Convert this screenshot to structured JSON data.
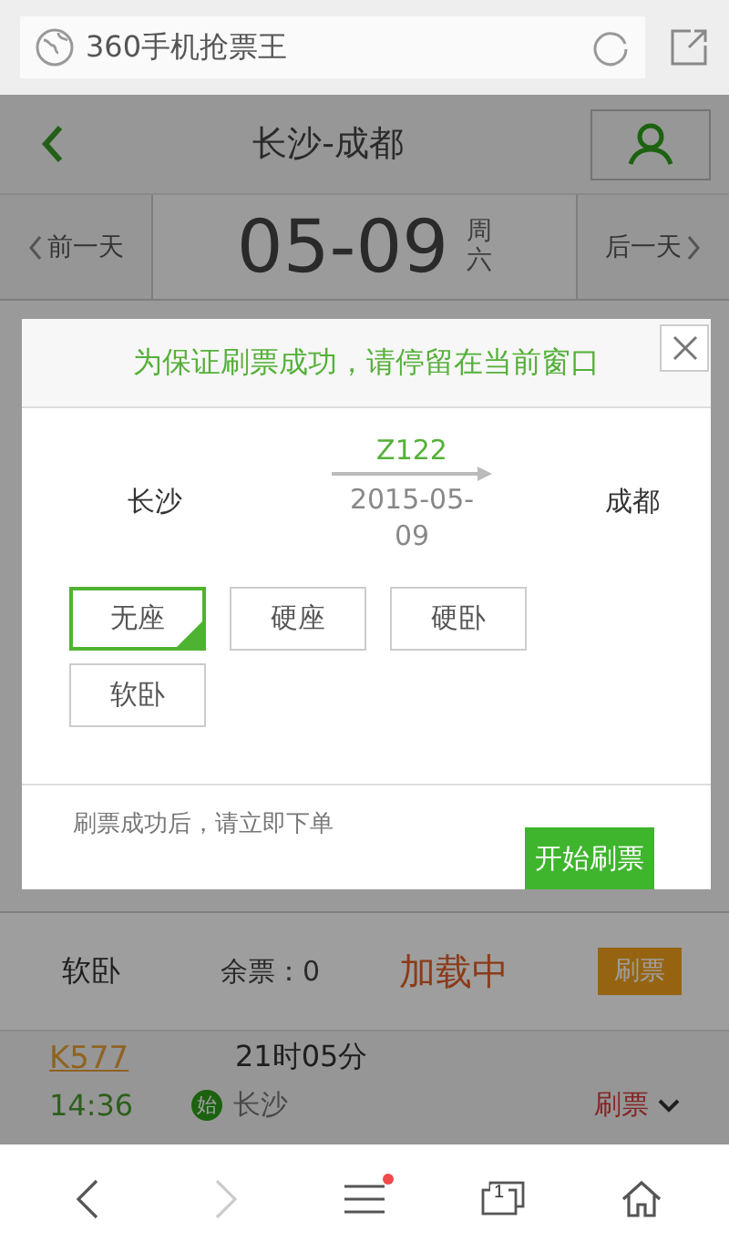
{
  "browser": {
    "title": "360手机抢票王"
  },
  "header": {
    "title": "长沙-成都"
  },
  "date_bar": {
    "prev": "前一天",
    "date": "05-09",
    "weekday": "周六",
    "next": "后一天"
  },
  "seat_row": {
    "seat": "软卧",
    "remaining": "余票：0",
    "status": "加载中",
    "button": "刷票"
  },
  "train": {
    "number": "K577",
    "duration": "21时05分",
    "depart_time": "14:36",
    "start_badge": "始",
    "station": "长沙",
    "action": "刷票"
  },
  "modal": {
    "title": "为保证刷票成功，请停留在当前窗口",
    "from": "长沙",
    "train": "Z122",
    "date": "2015-05-09",
    "to": "成都",
    "seats": [
      {
        "label": "无座",
        "selected": true
      },
      {
        "label": "硬座",
        "selected": false
      },
      {
        "label": "硬卧",
        "selected": false
      },
      {
        "label": "软卧",
        "selected": false
      }
    ],
    "note": "刷票成功后，请立即下单",
    "button": "开始刷票"
  },
  "bottom_nav": {
    "tabs_count": "1",
    "menu_badge": true
  }
}
